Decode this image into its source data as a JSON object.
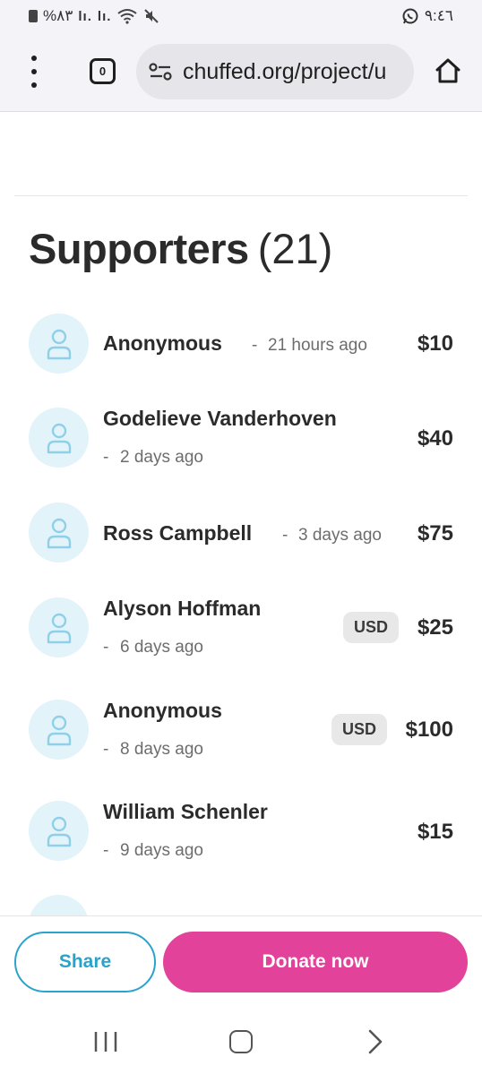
{
  "status_bar": {
    "left_text": "%٨٣",
    "signal_1": "lı.",
    "signal_2": "lı.",
    "wifi_suffix": "+",
    "time": "٩:٤٦"
  },
  "browser": {
    "tab_count": "0",
    "url": "chuffed.org/project/u",
    "icons": [
      "menu-dots-icon",
      "tabs-icon",
      "site-settings-icon",
      "home-icon"
    ]
  },
  "supporters": {
    "title": "Supporters",
    "count": "(21)",
    "list": [
      {
        "name": "Anonymous",
        "time": "21 hours ago",
        "amount": "$10",
        "currency": ""
      },
      {
        "name": "Godelieve Vanderhoven",
        "time": "2 days ago",
        "amount": "$40",
        "currency": ""
      },
      {
        "name": "Ross Campbell",
        "time": "3 days ago",
        "amount": "$75",
        "currency": ""
      },
      {
        "name": "Alyson Hoffman",
        "time": "6 days ago",
        "amount": "$25",
        "currency": "USD"
      },
      {
        "name": "Anonymous",
        "time": "8 days ago",
        "amount": "$100",
        "currency": "USD"
      },
      {
        "name": "William Schenler",
        "time": "9 days ago",
        "amount": "$15",
        "currency": ""
      }
    ],
    "time_separator": "-"
  },
  "actions": {
    "share_label": "Share",
    "donate_label": "Donate now"
  },
  "colors": {
    "share": "#2aa3cc",
    "donate": "#e2429a",
    "avatar_bg": "#e3f3fa",
    "avatar_icon": "#8fd0e8"
  }
}
